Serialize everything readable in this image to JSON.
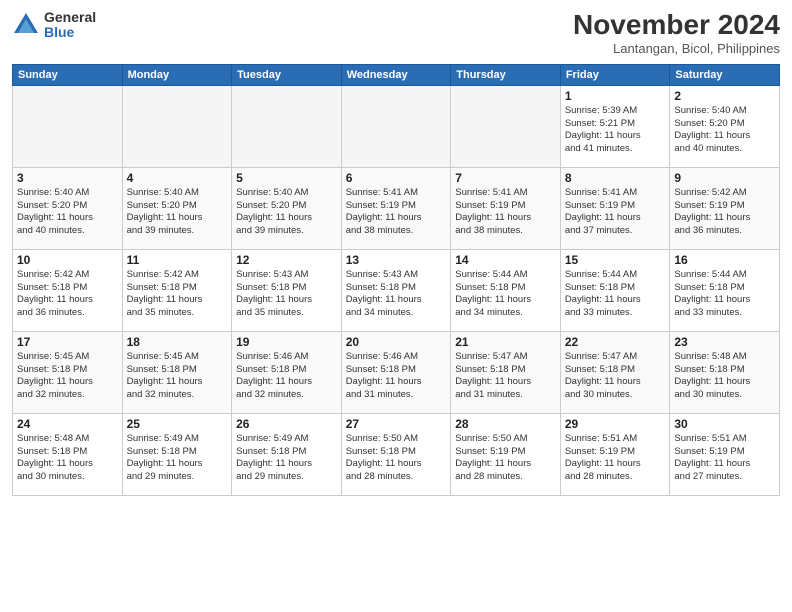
{
  "logo": {
    "general": "General",
    "blue": "Blue"
  },
  "title": "November 2024",
  "subtitle": "Lantangan, Bicol, Philippines",
  "weekdays": [
    "Sunday",
    "Monday",
    "Tuesday",
    "Wednesday",
    "Thursday",
    "Friday",
    "Saturday"
  ],
  "weeks": [
    [
      {
        "day": "",
        "info": ""
      },
      {
        "day": "",
        "info": ""
      },
      {
        "day": "",
        "info": ""
      },
      {
        "day": "",
        "info": ""
      },
      {
        "day": "",
        "info": ""
      },
      {
        "day": "1",
        "info": "Sunrise: 5:39 AM\nSunset: 5:21 PM\nDaylight: 11 hours\nand 41 minutes."
      },
      {
        "day": "2",
        "info": "Sunrise: 5:40 AM\nSunset: 5:20 PM\nDaylight: 11 hours\nand 40 minutes."
      }
    ],
    [
      {
        "day": "3",
        "info": "Sunrise: 5:40 AM\nSunset: 5:20 PM\nDaylight: 11 hours\nand 40 minutes."
      },
      {
        "day": "4",
        "info": "Sunrise: 5:40 AM\nSunset: 5:20 PM\nDaylight: 11 hours\nand 39 minutes."
      },
      {
        "day": "5",
        "info": "Sunrise: 5:40 AM\nSunset: 5:20 PM\nDaylight: 11 hours\nand 39 minutes."
      },
      {
        "day": "6",
        "info": "Sunrise: 5:41 AM\nSunset: 5:19 PM\nDaylight: 11 hours\nand 38 minutes."
      },
      {
        "day": "7",
        "info": "Sunrise: 5:41 AM\nSunset: 5:19 PM\nDaylight: 11 hours\nand 38 minutes."
      },
      {
        "day": "8",
        "info": "Sunrise: 5:41 AM\nSunset: 5:19 PM\nDaylight: 11 hours\nand 37 minutes."
      },
      {
        "day": "9",
        "info": "Sunrise: 5:42 AM\nSunset: 5:19 PM\nDaylight: 11 hours\nand 36 minutes."
      }
    ],
    [
      {
        "day": "10",
        "info": "Sunrise: 5:42 AM\nSunset: 5:18 PM\nDaylight: 11 hours\nand 36 minutes."
      },
      {
        "day": "11",
        "info": "Sunrise: 5:42 AM\nSunset: 5:18 PM\nDaylight: 11 hours\nand 35 minutes."
      },
      {
        "day": "12",
        "info": "Sunrise: 5:43 AM\nSunset: 5:18 PM\nDaylight: 11 hours\nand 35 minutes."
      },
      {
        "day": "13",
        "info": "Sunrise: 5:43 AM\nSunset: 5:18 PM\nDaylight: 11 hours\nand 34 minutes."
      },
      {
        "day": "14",
        "info": "Sunrise: 5:44 AM\nSunset: 5:18 PM\nDaylight: 11 hours\nand 34 minutes."
      },
      {
        "day": "15",
        "info": "Sunrise: 5:44 AM\nSunset: 5:18 PM\nDaylight: 11 hours\nand 33 minutes."
      },
      {
        "day": "16",
        "info": "Sunrise: 5:44 AM\nSunset: 5:18 PM\nDaylight: 11 hours\nand 33 minutes."
      }
    ],
    [
      {
        "day": "17",
        "info": "Sunrise: 5:45 AM\nSunset: 5:18 PM\nDaylight: 11 hours\nand 32 minutes."
      },
      {
        "day": "18",
        "info": "Sunrise: 5:45 AM\nSunset: 5:18 PM\nDaylight: 11 hours\nand 32 minutes."
      },
      {
        "day": "19",
        "info": "Sunrise: 5:46 AM\nSunset: 5:18 PM\nDaylight: 11 hours\nand 32 minutes."
      },
      {
        "day": "20",
        "info": "Sunrise: 5:46 AM\nSunset: 5:18 PM\nDaylight: 11 hours\nand 31 minutes."
      },
      {
        "day": "21",
        "info": "Sunrise: 5:47 AM\nSunset: 5:18 PM\nDaylight: 11 hours\nand 31 minutes."
      },
      {
        "day": "22",
        "info": "Sunrise: 5:47 AM\nSunset: 5:18 PM\nDaylight: 11 hours\nand 30 minutes."
      },
      {
        "day": "23",
        "info": "Sunrise: 5:48 AM\nSunset: 5:18 PM\nDaylight: 11 hours\nand 30 minutes."
      }
    ],
    [
      {
        "day": "24",
        "info": "Sunrise: 5:48 AM\nSunset: 5:18 PM\nDaylight: 11 hours\nand 30 minutes."
      },
      {
        "day": "25",
        "info": "Sunrise: 5:49 AM\nSunset: 5:18 PM\nDaylight: 11 hours\nand 29 minutes."
      },
      {
        "day": "26",
        "info": "Sunrise: 5:49 AM\nSunset: 5:18 PM\nDaylight: 11 hours\nand 29 minutes."
      },
      {
        "day": "27",
        "info": "Sunrise: 5:50 AM\nSunset: 5:18 PM\nDaylight: 11 hours\nand 28 minutes."
      },
      {
        "day": "28",
        "info": "Sunrise: 5:50 AM\nSunset: 5:19 PM\nDaylight: 11 hours\nand 28 minutes."
      },
      {
        "day": "29",
        "info": "Sunrise: 5:51 AM\nSunset: 5:19 PM\nDaylight: 11 hours\nand 28 minutes."
      },
      {
        "day": "30",
        "info": "Sunrise: 5:51 AM\nSunset: 5:19 PM\nDaylight: 11 hours\nand 27 minutes."
      }
    ]
  ]
}
